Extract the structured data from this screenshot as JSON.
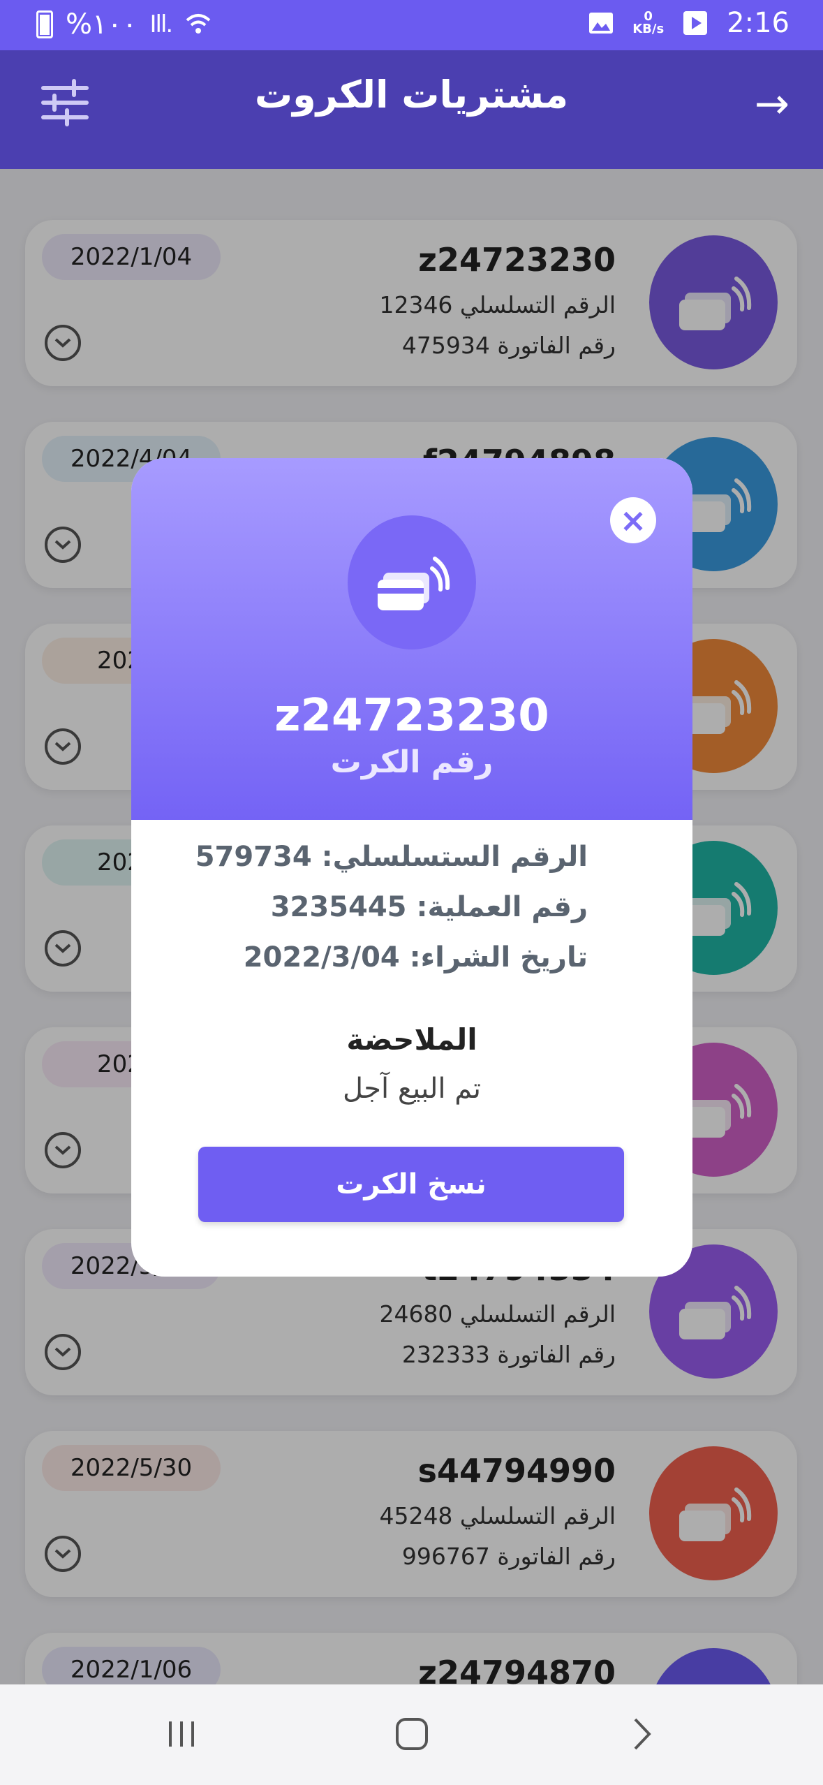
{
  "status_bar": {
    "battery": "%١٠٠",
    "signal": "Ill.",
    "speed_value": "0",
    "speed_unit": "KB/s",
    "time": "2:16"
  },
  "app_bar": {
    "title": "مشتريات الكروت",
    "back_icon": "arrow-right-icon",
    "filter_icon": "sliders-icon"
  },
  "cards": [
    {
      "code": "z24723230",
      "serial": "الرقم التسلسلي 12346",
      "invoice": "رقم الفاتورة 475934",
      "date": "2022/1/04",
      "color": "#7a5be0"
    },
    {
      "code": "f24794898",
      "serial": "",
      "invoice": "",
      "date": "2022/4/04",
      "color": "#3a9be0"
    },
    {
      "code": "",
      "serial": "",
      "invoice": "",
      "date": "2022/",
      "color": "#f08a3a"
    },
    {
      "code": "",
      "serial": "",
      "invoice": "",
      "date": "2022/",
      "color": "#1fb5a6"
    },
    {
      "code": "",
      "serial": "",
      "invoice": "",
      "date": "2022/",
      "color": "#d060c8"
    },
    {
      "code": "t24794334",
      "serial": "الرقم التسلسلي 24680",
      "invoice": "رقم الفاتورة 232333",
      "date": "2022/5/25",
      "color": "#9a5ef0"
    },
    {
      "code": "s44794990",
      "serial": "الرقم التسلسلي 45248",
      "invoice": "رقم الفاتورة 996767",
      "date": "2022/5/30",
      "color": "#f0604f"
    },
    {
      "code": "z24794870",
      "serial": "",
      "invoice": "",
      "date": "2022/1/06",
      "color": "#6b5bf0"
    }
  ],
  "modal": {
    "code": "z24723230",
    "code_label": "رقم الكرت",
    "serial": "الرقم الستسلسلي: 579734",
    "operation": "رقم العملية: 3235445",
    "purchase_date": "تاريخ الشراء: 2022/3/04",
    "note_title": "الملاحضة",
    "note_text": "تم البيع آجل",
    "copy_button": "نسخ الكرت",
    "close_icon": "close-icon"
  },
  "nav_bar": {
    "recents_icon": "recents-icon",
    "home_icon": "home-icon",
    "back_icon": "back-chevron-icon"
  }
}
